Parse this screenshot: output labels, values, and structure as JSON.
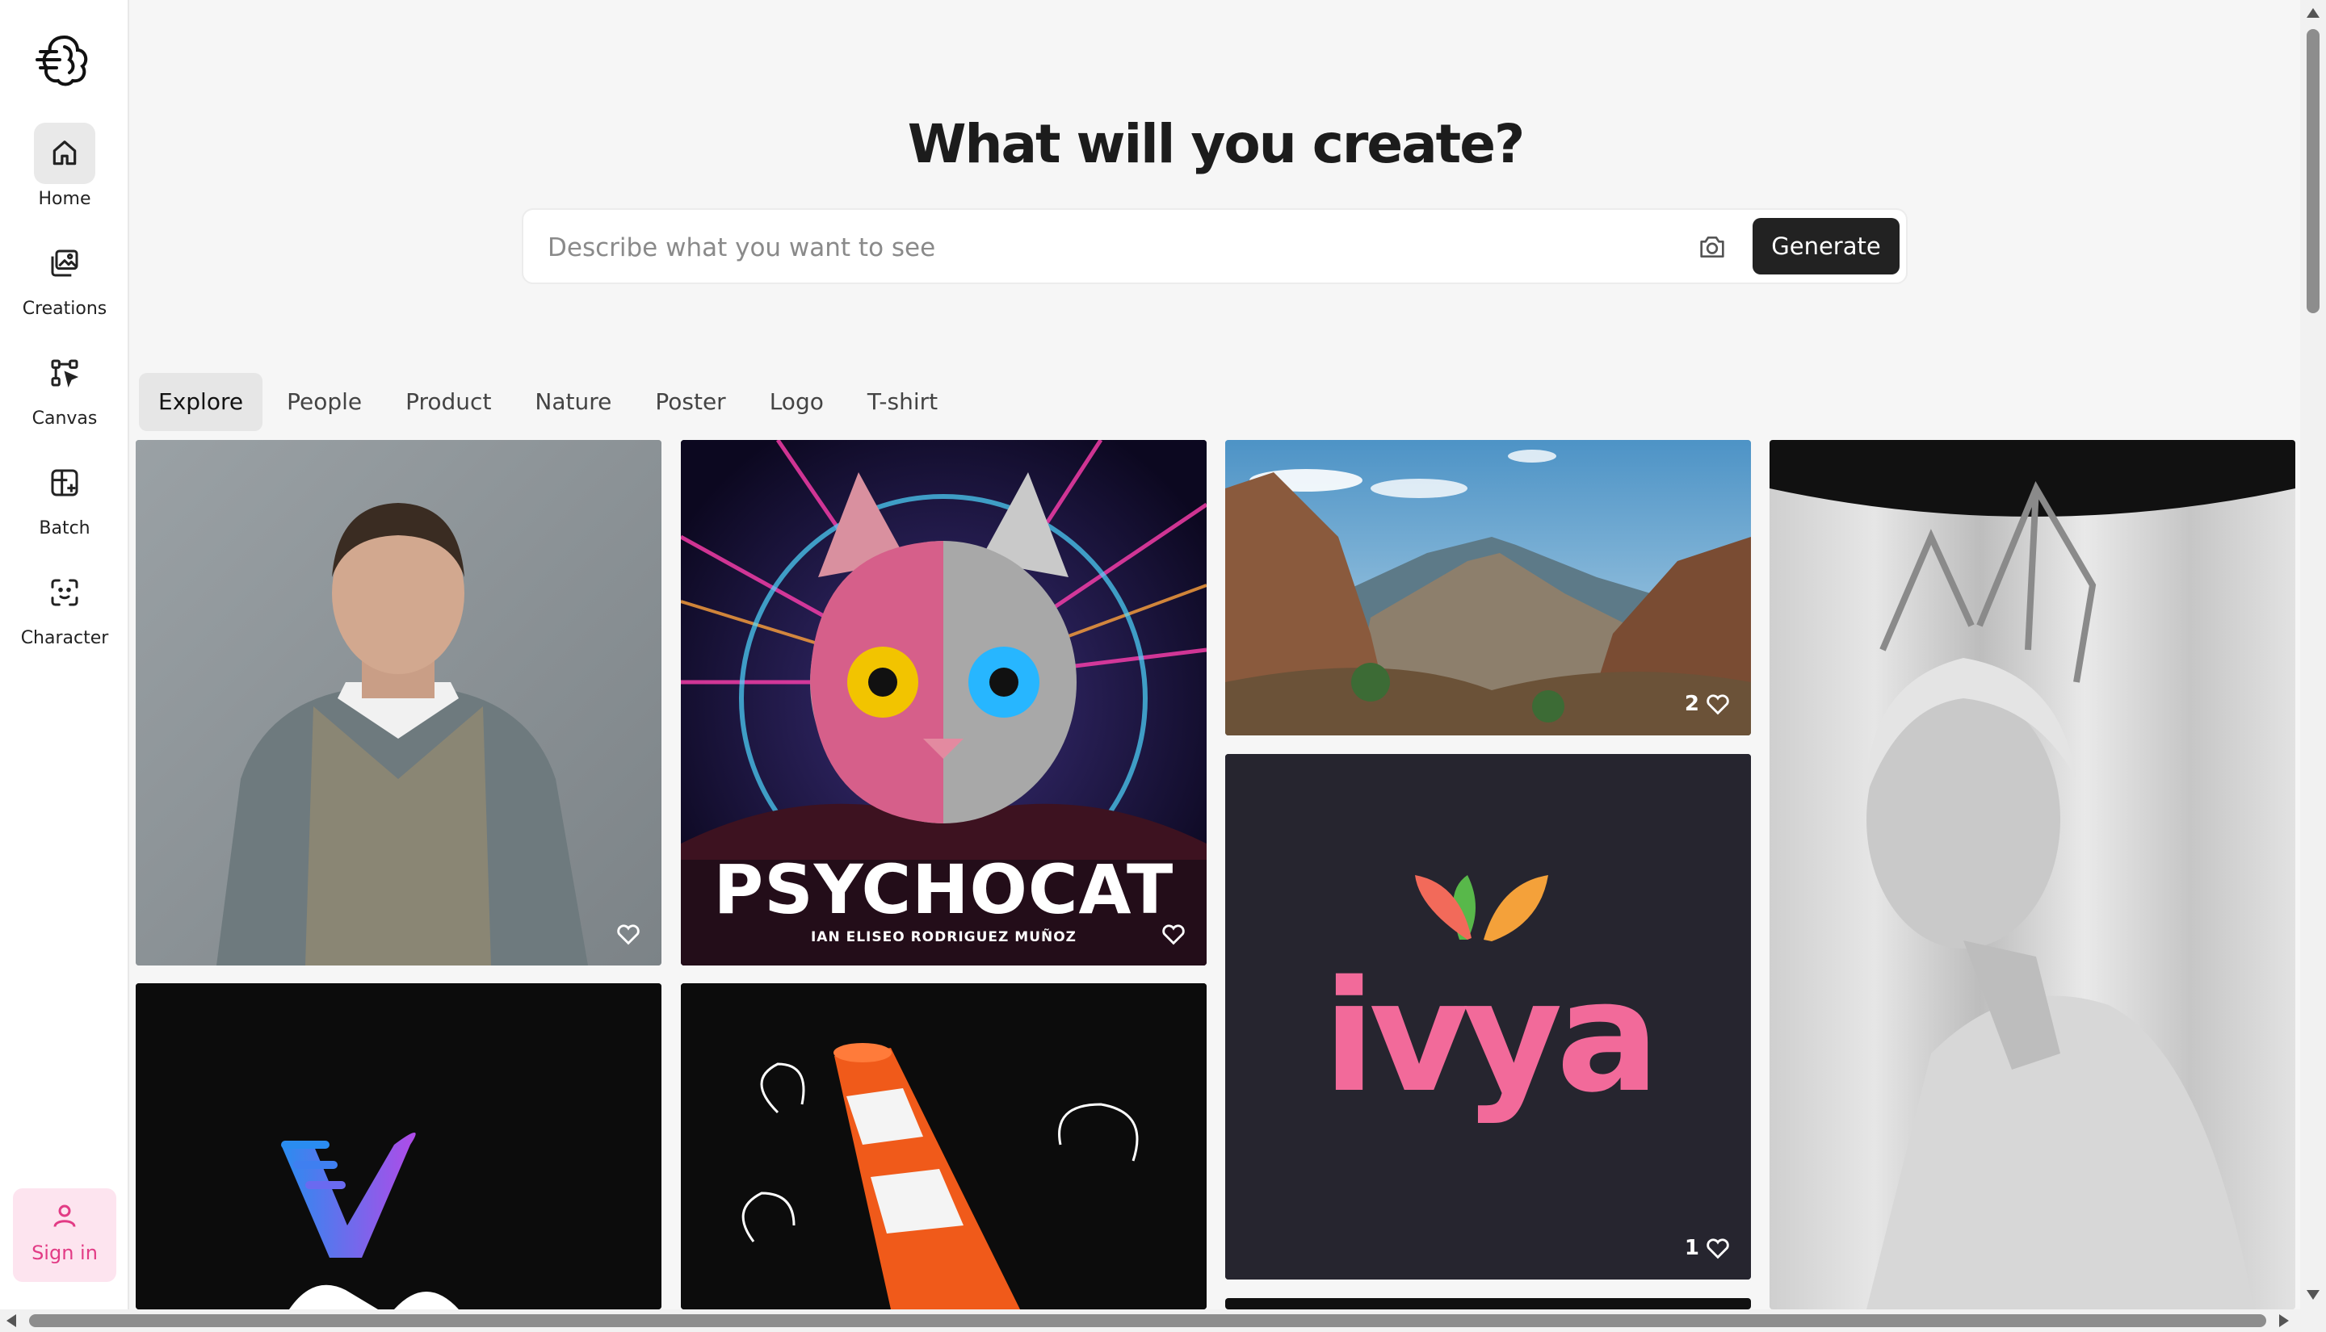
{
  "sidebar": {
    "logo": "brain-logo-icon",
    "items": [
      {
        "label": "Home",
        "icon": "home-icon",
        "active": true
      },
      {
        "label": "Creations",
        "icon": "images-icon"
      },
      {
        "label": "Canvas",
        "icon": "canvas-icon"
      },
      {
        "label": "Batch",
        "icon": "batch-icon"
      },
      {
        "label": "Character",
        "icon": "character-icon"
      }
    ],
    "signin_label": "Sign in"
  },
  "header": {
    "title": "What will you create?",
    "search_placeholder": "Describe what you want to see",
    "generate_label": "Generate"
  },
  "tabs": [
    "Explore",
    "People",
    "Product",
    "Nature",
    "Poster",
    "Logo",
    "T-shirt"
  ],
  "active_tab": "Explore",
  "gallery": {
    "psychocat_title": "PSYCHOCAT",
    "psychocat_subtitle": "IAN ELISEO RODRIGUEZ MUÑOZ",
    "logo_word": "ivya",
    "mountain_likes": "2",
    "logo_likes": "1"
  },
  "colors": {
    "accent_dark": "#222222",
    "signin_bg": "#fde4ef",
    "signin_fg": "#e23b85"
  }
}
